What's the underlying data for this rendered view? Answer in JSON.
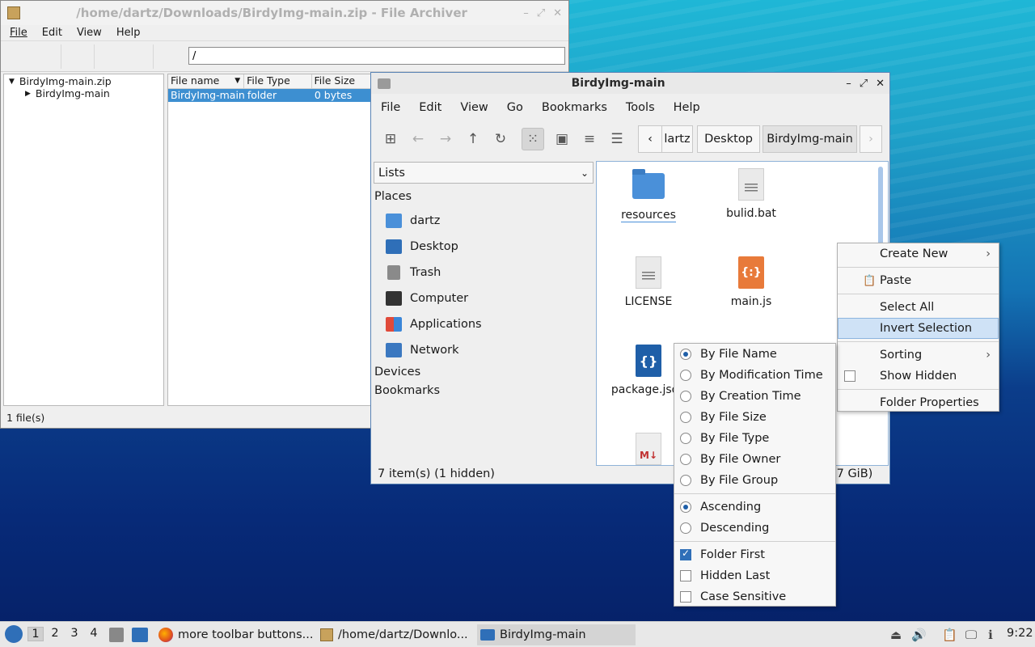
{
  "archiver": {
    "title": "/home/dartz/Downloads/BirdyImg-main.zip - File Archiver",
    "menu": [
      "File",
      "Edit",
      "View",
      "Help"
    ],
    "path": "/",
    "tree": [
      "BirdyImg-main.zip",
      "BirdyImg-main"
    ],
    "columns": [
      "File name",
      "File Type",
      "File Size"
    ],
    "row": {
      "name": "BirdyImg-main",
      "type": "folder",
      "size": "0 bytes"
    },
    "status": "1 file(s)"
  },
  "fm": {
    "title": "BirdyImg-main",
    "menu": [
      "File",
      "Edit",
      "View",
      "Go",
      "Bookmarks",
      "Tools",
      "Help"
    ],
    "breadcrumbs": [
      "lartz",
      "Desktop",
      "BirdyImg-main"
    ],
    "side_mode": "Lists",
    "places_header": "Places",
    "places": [
      "dartz",
      "Desktop",
      "Trash",
      "Computer",
      "Applications",
      "Network"
    ],
    "devices": "Devices",
    "bookmarks": "Bookmarks",
    "files": [
      "resources",
      "bulid.bat",
      "LICENSE",
      "main.js",
      "package.json"
    ],
    "md_label": "M↓",
    "status": "7 item(s) (1 hidden)",
    "status_right": ".7 GiB)"
  },
  "context_menu": {
    "create_new": "Create New",
    "paste": "Paste",
    "select_all": "Select All",
    "invert_selection": "Invert Selection",
    "sorting": "Sorting",
    "show_hidden": "Show Hidden",
    "folder_properties": "Folder Properties"
  },
  "sort_menu": {
    "by_file_name": "By File Name",
    "by_mod_time": "By Modification Time",
    "by_creation_time": "By Creation Time",
    "by_file_size": "By File Size",
    "by_file_type": "By File Type",
    "by_file_owner": "By File Owner",
    "by_file_group": "By File Group",
    "ascending": "Ascending",
    "descending": "Descending",
    "folder_first": "Folder First",
    "hidden_last": "Hidden Last",
    "case_sensitive": "Case Sensitive"
  },
  "taskbar": {
    "workspaces": [
      "1",
      "2",
      "3",
      "4"
    ],
    "tasks": [
      "more toolbar buttons...",
      "/home/dartz/Downlo...",
      "BirdyImg-main"
    ],
    "clock": "9:22"
  }
}
